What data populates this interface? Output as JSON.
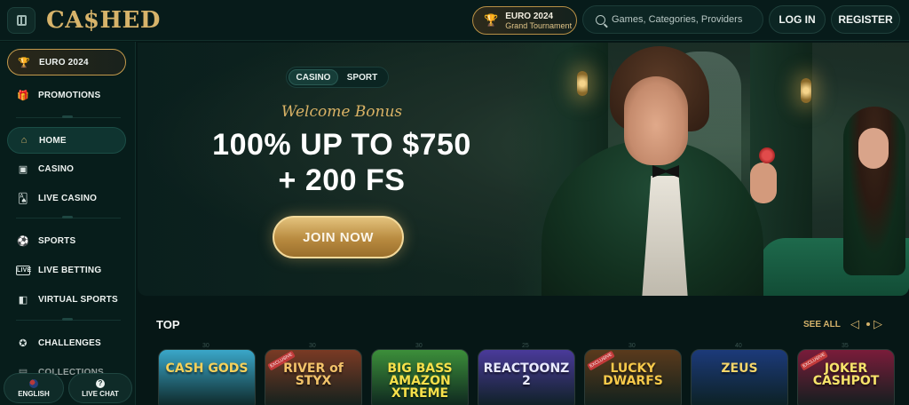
{
  "header": {
    "logo_text": "CA$HED",
    "euro_title": "EURO 2024",
    "euro_subtitle": "Grand Tournament",
    "search_placeholder": "Games, Categories, Providers",
    "login_label": "LOG IN",
    "register_label": "REGISTER"
  },
  "sidebar": {
    "items": [
      {
        "label": "EURO 2024",
        "icon": "trophy-icon"
      },
      {
        "label": "PROMOTIONS",
        "icon": "gift-icon"
      },
      {
        "label": "HOME",
        "icon": "home-icon"
      },
      {
        "label": "CASINO",
        "icon": "slot-machine-icon"
      },
      {
        "label": "LIVE CASINO",
        "icon": "cards-icon"
      },
      {
        "label": "SPORTS",
        "icon": "ball-icon"
      },
      {
        "label": "LIVE BETTING",
        "icon": "live-icon"
      },
      {
        "label": "VIRTUAL SPORTS",
        "icon": "virtual-icon"
      },
      {
        "label": "CHALLENGES",
        "icon": "medal-icon"
      },
      {
        "label": "COLLECTIONS",
        "icon": "collection-icon"
      }
    ],
    "language_label": "ENGLISH",
    "live_chat_label": "LIVE CHAT"
  },
  "hero": {
    "tabs": [
      "CASINO",
      "SPORT"
    ],
    "active_tab": "CASINO",
    "welcome_text": "Welcome Bonus",
    "bonus_line1": "100% UP TO $750",
    "bonus_line2": "+ 200 FS",
    "cta_label": "JOIN NOW"
  },
  "top_section": {
    "title": "TOP",
    "see_all_label": "SEE ALL",
    "games": [
      {
        "name": "CASH GODS",
        "num": "30",
        "exclusive": false,
        "bg": "#3aa7c9",
        "color": "#f6d15a"
      },
      {
        "name": "RIVER of STYX",
        "num": "30",
        "exclusive": true,
        "bg": "#7a3a24",
        "color": "#f3c36a"
      },
      {
        "name": "BIG BASS AMAZON XTREME",
        "num": "30",
        "exclusive": false,
        "bg": "#3c8f3a",
        "color": "#f6e04a"
      },
      {
        "name": "REACTOONZ 2",
        "num": "25",
        "exclusive": false,
        "bg": "#4a3a9a",
        "color": "#e9eaff"
      },
      {
        "name": "LUCKY DWARFS",
        "num": "30",
        "exclusive": true,
        "bg": "#5a3a1c",
        "color": "#f7c94a"
      },
      {
        "name": "ZEUS",
        "num": "40",
        "exclusive": false,
        "bg": "#1c3a7a",
        "color": "#f6d66a"
      },
      {
        "name": "JOKER CASHPOT",
        "num": "35",
        "exclusive": true,
        "bg": "#7a1c3a",
        "color": "#f7e36a"
      }
    ]
  },
  "colors": {
    "accent_gold": "#d4b26a",
    "background": "#061716",
    "panel": "#071d1b"
  }
}
